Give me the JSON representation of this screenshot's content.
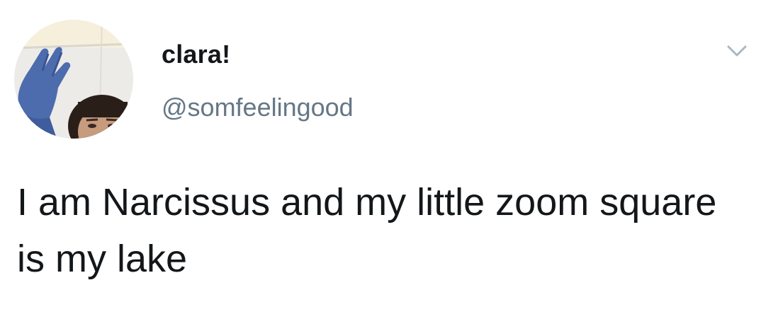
{
  "tweet": {
    "author": {
      "display_name": "clara!",
      "handle": "@somfeelingood",
      "avatar_icon": "profile-photo"
    },
    "menu_icon": "chevron-down-icon",
    "text": "I am Narcissus and my little zoom square is my lake"
  },
  "colors": {
    "text_primary": "#14171a",
    "text_secondary": "#657786",
    "chevron": "#aab8c2",
    "background": "#ffffff"
  }
}
